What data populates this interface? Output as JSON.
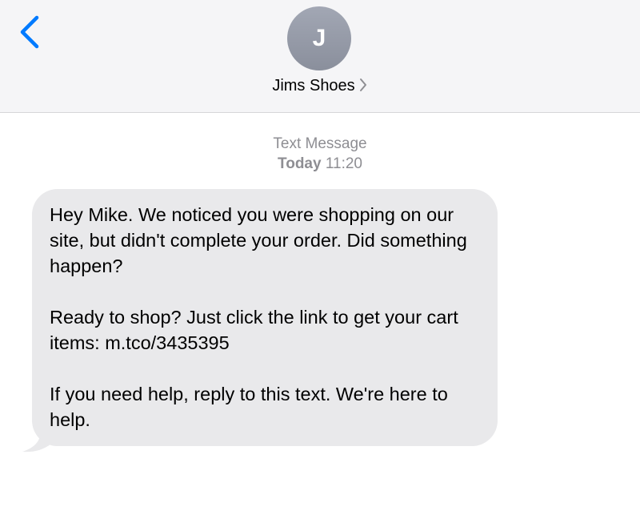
{
  "header": {
    "contact_initial": "J",
    "contact_name": "Jims Shoes",
    "back_icon": "chevron-left-icon",
    "details_icon": "chevron-right-icon",
    "accent_color": "#007aff"
  },
  "conversation": {
    "service_label": "Text Message",
    "day": "Today",
    "time": "11:20",
    "messages": [
      {
        "direction": "incoming",
        "text": "Hey Mike. We noticed you were shopping on our site, but didn't complete your order. Did something happen?\n\nReady to shop? Just click the link to get your cart items: m.tco/3435395\n\nIf you need help, reply to this text. We're here to help.",
        "bubble_color": "#e9e9eb"
      }
    ]
  }
}
